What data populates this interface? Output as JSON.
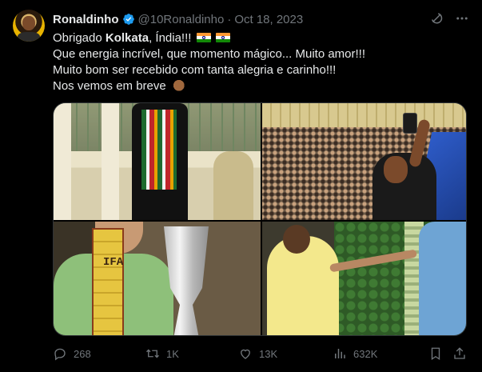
{
  "author": {
    "name": "Ronaldinho",
    "handle": "@10Ronaldinho",
    "separator": "·",
    "date": "Oct 18, 2023"
  },
  "text": {
    "line1_prefix": "Obrigado ",
    "line1_bold": "Kolkata",
    "line1_suffix": ", Índia!!! ",
    "line2": "Que energia incrível, que momento mágico... Muito amor!!!",
    "line3": "Muito bom ser recebido com tanta alegria e carinho!!!",
    "line4": "Nos vemos em breve "
  },
  "media": {
    "photo3_sash_letters": "IFA"
  },
  "actions": {
    "replies": "268",
    "retweets": "1K",
    "likes": "13K",
    "views": "632K"
  },
  "colors": {
    "background": "#000000",
    "text": "#e7e9ea",
    "muted": "#71767b",
    "verified": "#1d9bf0",
    "border": "#2f3336"
  },
  "icons": [
    "verified-badge-icon",
    "grok-icon",
    "more-icon",
    "india-flag-icon",
    "call-me-hand-icon",
    "reply-icon",
    "retweet-icon",
    "like-icon",
    "views-icon",
    "bookmark-icon",
    "share-icon"
  ]
}
